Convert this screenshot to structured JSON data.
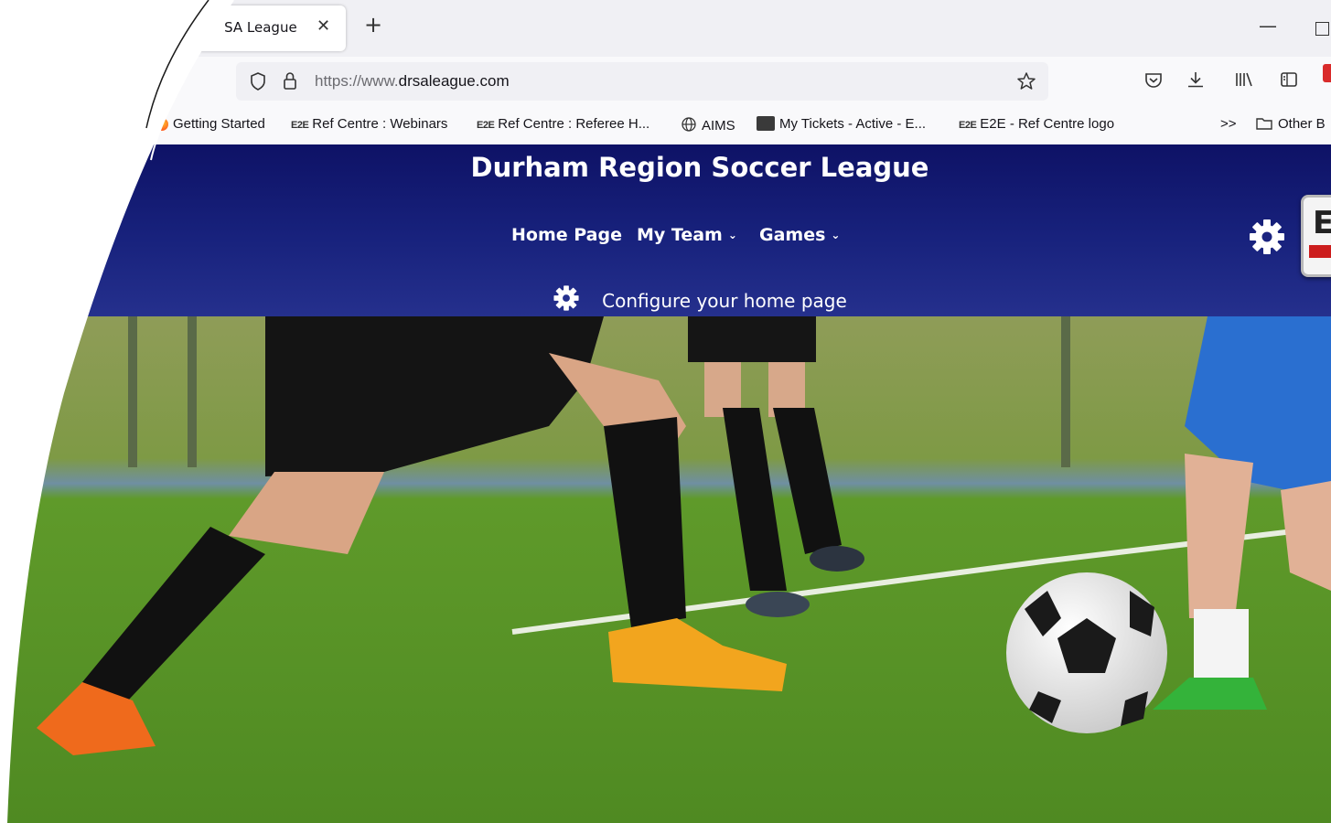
{
  "browser": {
    "tab_title": "D’ SA League",
    "url_prefix": "https://www.",
    "url_domain": "drsaleague.com",
    "bookmarks": [
      {
        "label": "Getting Started",
        "badge": ""
      },
      {
        "label": "Ref Centre : Webinars",
        "badge": "E2E"
      },
      {
        "label": "Ref Centre : Referee H...",
        "badge": "E2E"
      },
      {
        "label": "AIMS",
        "badge": ""
      },
      {
        "label": "My Tickets - Active - E...",
        "badge": ""
      },
      {
        "label": "E2E - Ref Centre logo",
        "badge": "E2E"
      }
    ],
    "bookmarks_more": ">>",
    "other_bookmarks": "Other B"
  },
  "site": {
    "title": "Durham Region Soccer League",
    "nav": [
      {
        "label": "Home Page",
        "has_dropdown": false
      },
      {
        "label": "My Team",
        "has_dropdown": true
      },
      {
        "label": "Games",
        "has_dropdown": true
      }
    ],
    "configure_label": "Configure your home page",
    "logo_letter": "E"
  },
  "colors": {
    "header_top": "#0e1266",
    "header_bottom": "#25308d",
    "grass": "#5f9a2a",
    "logo_red": "#cc1d1d"
  },
  "icons": [
    "shield-icon",
    "lock-icon",
    "star-icon",
    "pocket-icon",
    "download-icon",
    "library-icon",
    "sidebar-icon",
    "globe-icon",
    "folder-icon",
    "gear-icon",
    "chevron-down-icon",
    "close-icon",
    "plus-icon"
  ]
}
